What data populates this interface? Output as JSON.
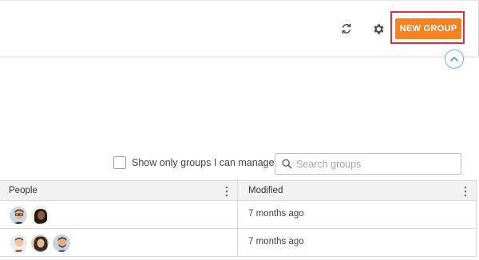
{
  "toolbar": {
    "refresh_icon": "refresh-icon",
    "settings_icon": "gear-icon",
    "new_group_label": "NEW GROUP",
    "accent_color": "#f58220",
    "highlight_color": "#e0303a"
  },
  "filters": {
    "manage_only_label": "Show only groups I can manage",
    "manage_only_checked": false,
    "search_placeholder": "Search groups"
  },
  "table": {
    "columns": [
      "People",
      "Modified"
    ],
    "rows": [
      {
        "avatars": [
          "man-glasses",
          "woman-dark-hair"
        ],
        "modified": "7 months ago"
      },
      {
        "avatars": [
          "man-smiling",
          "woman-curly-hair",
          "man-beard"
        ],
        "modified": "7 months ago"
      }
    ]
  }
}
